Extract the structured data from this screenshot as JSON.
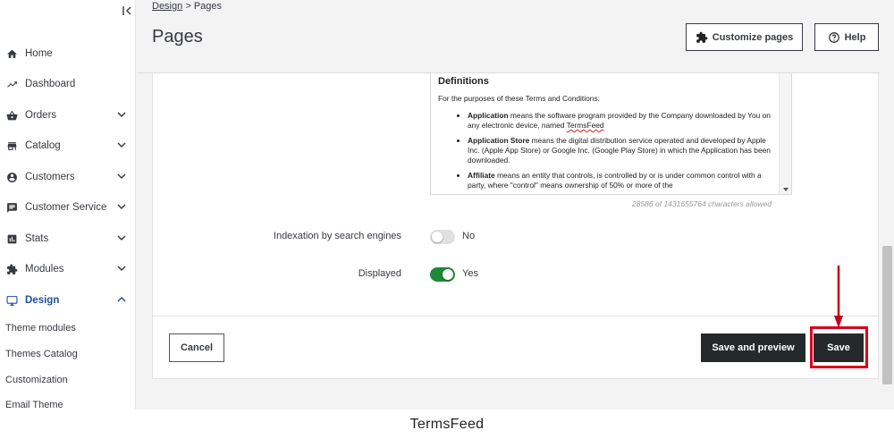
{
  "sidebar": {
    "items": [
      {
        "label": "Home",
        "icon": "home-icon",
        "chevron": false
      },
      {
        "label": "Dashboard",
        "icon": "trending-up-icon",
        "chevron": false
      },
      {
        "label": "Orders",
        "icon": "basket-icon",
        "chevron": true
      },
      {
        "label": "Catalog",
        "icon": "store-icon",
        "chevron": true
      },
      {
        "label": "Customers",
        "icon": "user-circle-icon",
        "chevron": true
      },
      {
        "label": "Customer Service",
        "icon": "chat-icon",
        "chevron": true
      },
      {
        "label": "Stats",
        "icon": "bar-chart-icon",
        "chevron": true
      },
      {
        "label": "Modules",
        "icon": "puzzle-icon",
        "chevron": true
      },
      {
        "label": "Design",
        "icon": "monitor-icon",
        "chevron": true,
        "active": true
      }
    ],
    "sub_items": [
      "Theme modules",
      "Themes Catalog",
      "Customization",
      "Email Theme"
    ]
  },
  "header": {
    "breadcrumb_parent": "Design",
    "breadcrumb_separator": ">",
    "breadcrumb_current": "Pages",
    "title": "Pages",
    "customize_label": "Customize pages",
    "help_label": "Help"
  },
  "editor": {
    "heading": "Definitions",
    "intro": "For the purposes of these Terms and Conditions:",
    "definitions": [
      {
        "term": "Application",
        "text_before": " means the software program provided by the Company downloaded by You on any electronic device, named ",
        "underlined": "TermsFeed",
        "text_after": ""
      },
      {
        "term": "Application Store",
        "text_before": " means the digital distribution service operated and developed by Apple Inc. (Apple App Store) or Google Inc. (Google Play Store) in which the Application has been downloaded.",
        "underlined": "",
        "text_after": ""
      },
      {
        "term": "Affiliate",
        "text_before": " means an entity that controls, is controlled by or is under common control with a party, where \"control\" means ownership of 50% or more of the",
        "underlined": "",
        "text_after": ""
      }
    ],
    "char_count": "28586 of 1431655764 characters allowed"
  },
  "form": {
    "indexation_label": "Indexation by search engines",
    "indexation_value": "No",
    "displayed_label": "Displayed",
    "displayed_value": "Yes"
  },
  "footer": {
    "cancel_label": "Cancel",
    "save_preview_label": "Save and preview",
    "save_label": "Save"
  },
  "caption": "TermsFeed",
  "colors": {
    "accent_blue": "#1b4f9c",
    "toggle_on": "#218838",
    "dark_button": "#25292c",
    "highlight_red": "#d9001b"
  }
}
